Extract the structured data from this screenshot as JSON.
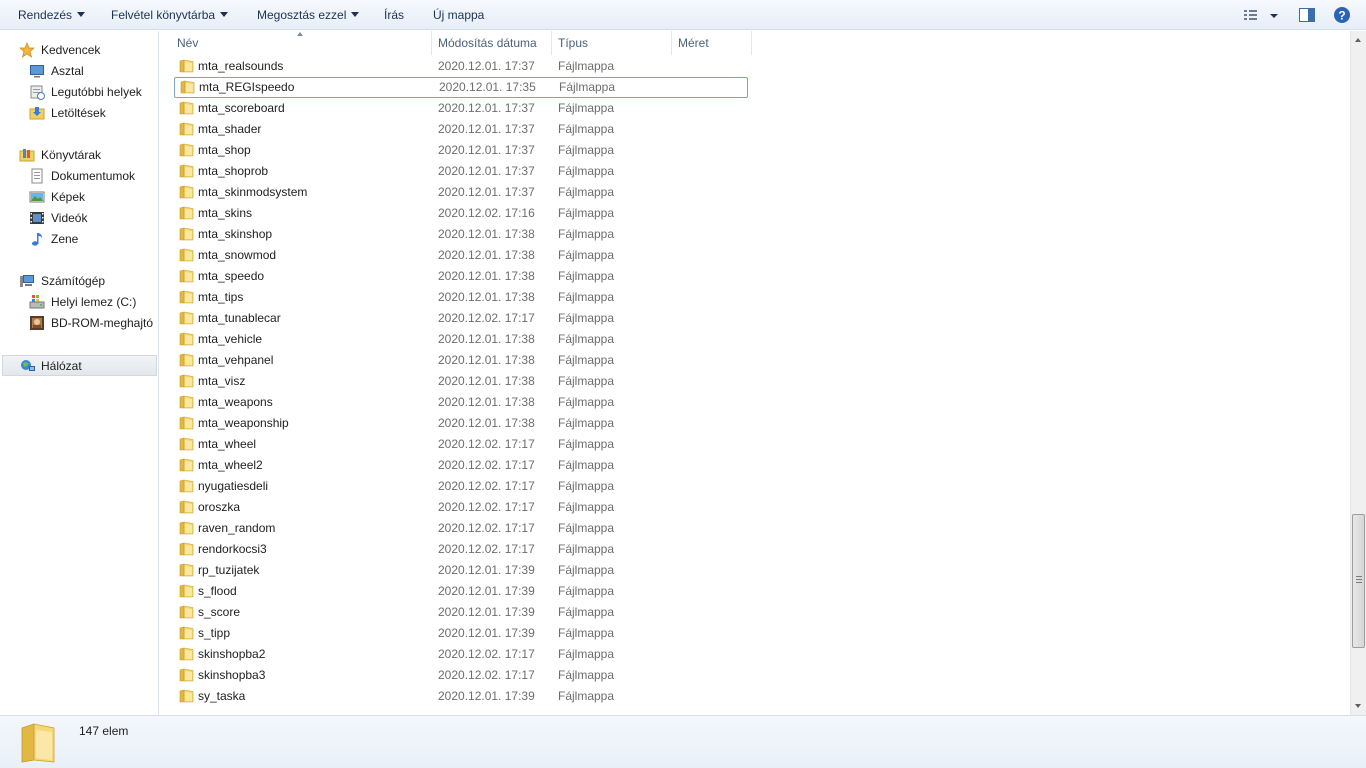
{
  "toolbar": {
    "organize": "Rendezés",
    "include_library": "Felvétel könyvtárba",
    "share_with": "Megosztás ezzel",
    "burn": "Írás",
    "new_folder": "Új mappa"
  },
  "nav": {
    "favorites": {
      "label": "Kedvencek",
      "items": [
        "Asztal",
        "Legutóbbi helyek",
        "Letöltések"
      ]
    },
    "libraries": {
      "label": "Könyvtárak",
      "items": [
        "Dokumentumok",
        "Képek",
        "Videók",
        "Zene"
      ]
    },
    "computer": {
      "label": "Számítógép",
      "items": [
        "Helyi lemez (C:)",
        "BD-ROM-meghajtó"
      ]
    },
    "network": {
      "label": "Hálózat"
    }
  },
  "columns": {
    "name": "Név",
    "modified": "Módosítás dátuma",
    "type": "Típus",
    "size": "Méret"
  },
  "files": [
    {
      "name": "mta_realsounds",
      "date": "2020.12.01. 17:37",
      "type": "Fájlmappa"
    },
    {
      "name": "mta_REGIspeedo",
      "date": "2020.12.01. 17:35",
      "type": "Fájlmappa"
    },
    {
      "name": "mta_scoreboard",
      "date": "2020.12.01. 17:37",
      "type": "Fájlmappa"
    },
    {
      "name": "mta_shader",
      "date": "2020.12.01. 17:37",
      "type": "Fájlmappa"
    },
    {
      "name": "mta_shop",
      "date": "2020.12.01. 17:37",
      "type": "Fájlmappa"
    },
    {
      "name": "mta_shoprob",
      "date": "2020.12.01. 17:37",
      "type": "Fájlmappa"
    },
    {
      "name": "mta_skinmodsystem",
      "date": "2020.12.01. 17:37",
      "type": "Fájlmappa"
    },
    {
      "name": "mta_skins",
      "date": "2020.12.02. 17:16",
      "type": "Fájlmappa"
    },
    {
      "name": "mta_skinshop",
      "date": "2020.12.01. 17:38",
      "type": "Fájlmappa"
    },
    {
      "name": "mta_snowmod",
      "date": "2020.12.01. 17:38",
      "type": "Fájlmappa"
    },
    {
      "name": "mta_speedo",
      "date": "2020.12.01. 17:38",
      "type": "Fájlmappa"
    },
    {
      "name": "mta_tips",
      "date": "2020.12.01. 17:38",
      "type": "Fájlmappa"
    },
    {
      "name": "mta_tunablecar",
      "date": "2020.12.02. 17:17",
      "type": "Fájlmappa"
    },
    {
      "name": "mta_vehicle",
      "date": "2020.12.01. 17:38",
      "type": "Fájlmappa"
    },
    {
      "name": "mta_vehpanel",
      "date": "2020.12.01. 17:38",
      "type": "Fájlmappa"
    },
    {
      "name": "mta_visz",
      "date": "2020.12.01. 17:38",
      "type": "Fájlmappa"
    },
    {
      "name": "mta_weapons",
      "date": "2020.12.01. 17:38",
      "type": "Fájlmappa"
    },
    {
      "name": "mta_weaponship",
      "date": "2020.12.01. 17:38",
      "type": "Fájlmappa"
    },
    {
      "name": "mta_wheel",
      "date": "2020.12.02. 17:17",
      "type": "Fájlmappa"
    },
    {
      "name": "mta_wheel2",
      "date": "2020.12.02. 17:17",
      "type": "Fájlmappa"
    },
    {
      "name": "nyugatiesdeli",
      "date": "2020.12.02. 17:17",
      "type": "Fájlmappa"
    },
    {
      "name": "oroszka",
      "date": "2020.12.02. 17:17",
      "type": "Fájlmappa"
    },
    {
      "name": "raven_random",
      "date": "2020.12.02. 17:17",
      "type": "Fájlmappa"
    },
    {
      "name": "rendorkocsi3",
      "date": "2020.12.02. 17:17",
      "type": "Fájlmappa"
    },
    {
      "name": "rp_tuzijatek",
      "date": "2020.12.01. 17:39",
      "type": "Fájlmappa"
    },
    {
      "name": "s_flood",
      "date": "2020.12.01. 17:39",
      "type": "Fájlmappa"
    },
    {
      "name": "s_score",
      "date": "2020.12.01. 17:39",
      "type": "Fájlmappa"
    },
    {
      "name": "s_tipp",
      "date": "2020.12.01. 17:39",
      "type": "Fájlmappa"
    },
    {
      "name": "skinshopba2",
      "date": "2020.12.02. 17:17",
      "type": "Fájlmappa"
    },
    {
      "name": "skinshopba3",
      "date": "2020.12.02. 17:17",
      "type": "Fájlmappa"
    },
    {
      "name": "sy_taska",
      "date": "2020.12.01. 17:39",
      "type": "Fájlmappa"
    }
  ],
  "focused_index": 1,
  "status": {
    "count_text": "147 elem"
  },
  "colors": {
    "folder_yellow": "#f2cf62",
    "focus_border": "#7da2ce",
    "toolbar_text": "#1e3250"
  }
}
